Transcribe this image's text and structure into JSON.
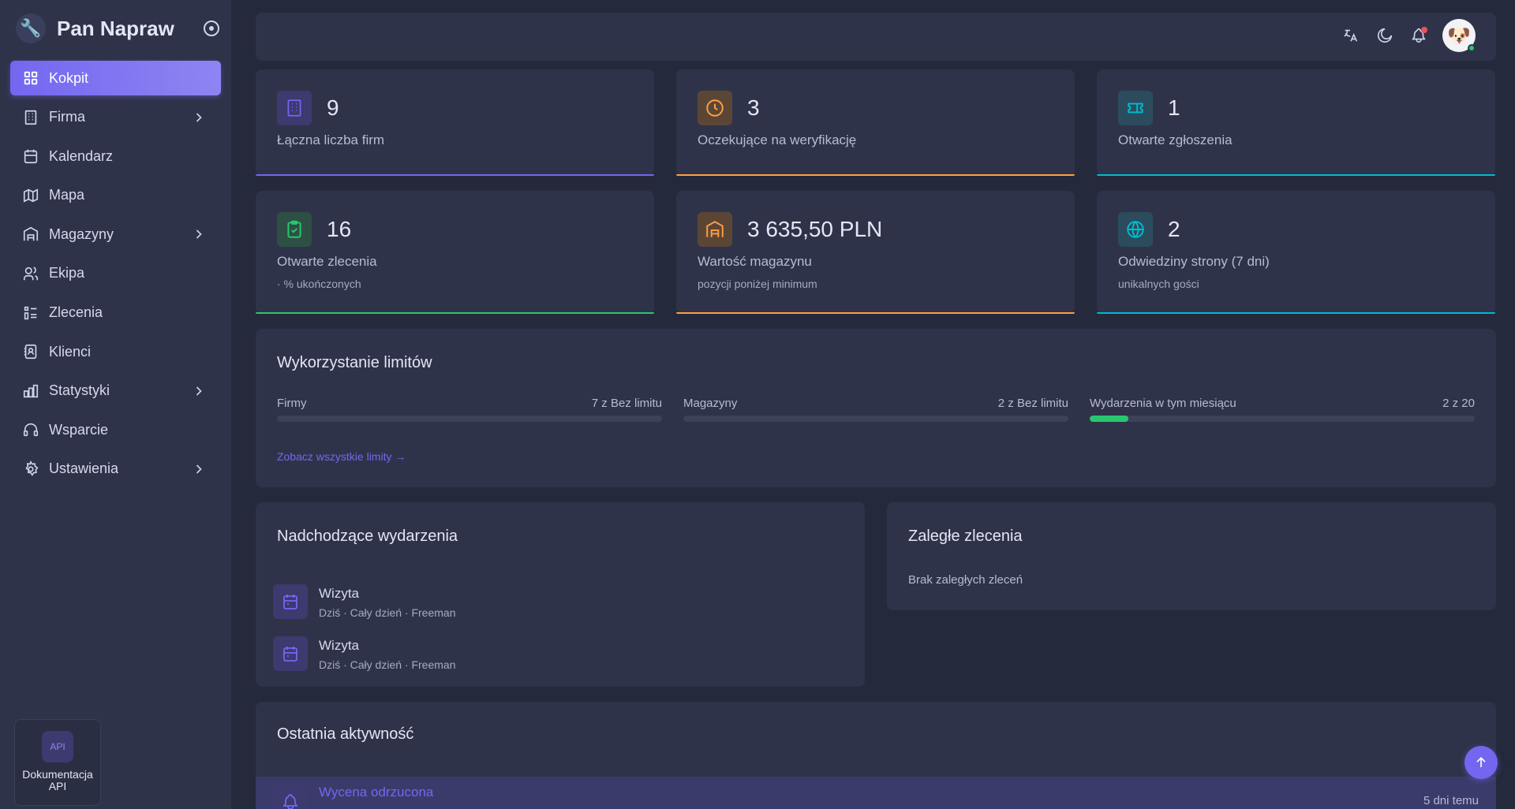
{
  "brand": {
    "name": "Pan Napraw",
    "logo_icon": "mechanic-logo"
  },
  "sidebar": {
    "items": [
      {
        "label": "Kokpit",
        "icon": "dashboard-icon",
        "active": true,
        "has_children": false
      },
      {
        "label": "Firma",
        "icon": "building-icon",
        "active": false,
        "has_children": true
      },
      {
        "label": "Kalendarz",
        "icon": "calendar-icon",
        "active": false,
        "has_children": false
      },
      {
        "label": "Mapa",
        "icon": "map-icon",
        "active": false,
        "has_children": false
      },
      {
        "label": "Magazyny",
        "icon": "warehouse-icon",
        "active": false,
        "has_children": true
      },
      {
        "label": "Ekipa",
        "icon": "users-icon",
        "active": false,
        "has_children": false
      },
      {
        "label": "Zlecenia",
        "icon": "tasks-icon",
        "active": false,
        "has_children": false
      },
      {
        "label": "Klienci",
        "icon": "address-book-icon",
        "active": false,
        "has_children": false
      },
      {
        "label": "Statystyki",
        "icon": "chart-bar-icon",
        "active": false,
        "has_children": true
      },
      {
        "label": "Wsparcie",
        "icon": "headset-icon",
        "active": false,
        "has_children": false
      },
      {
        "label": "Ustawienia",
        "icon": "settings-icon",
        "active": false,
        "has_children": true
      }
    ],
    "api_card": {
      "badge": "API",
      "label_line1": "Dokumentacja",
      "label_line2": "API"
    }
  },
  "topbar": {
    "icons": [
      "translate-icon",
      "moon-icon",
      "bell-icon"
    ],
    "has_notification": true,
    "avatar_status": "online"
  },
  "stats": [
    {
      "value": "9",
      "label": "Łączna liczba firm",
      "sub": "",
      "icon": "building-icon",
      "color": "#7367f0"
    },
    {
      "value": "3",
      "label": "Oczekujące na weryfikację",
      "sub": "",
      "icon": "clock-icon",
      "color": "#ff9f43"
    },
    {
      "value": "1",
      "label": "Otwarte zgłoszenia",
      "sub": "",
      "icon": "ticket-icon",
      "color": "#00bad1"
    },
    {
      "value": "16",
      "label": "Otwarte zlecenia",
      "sub": "· % ukończonych",
      "icon": "clipboard-icon",
      "color": "#28c76f"
    },
    {
      "value": "3 635,50 PLN",
      "label": "Wartość magazynu",
      "sub": "pozycji poniżej minimum",
      "icon": "warehouse-icon",
      "color": "#ff9f43"
    },
    {
      "value": "2",
      "label": "Odwiedziny strony (7 dni)",
      "sub": "unikalnych gości",
      "icon": "globe-icon",
      "color": "#00bad1"
    }
  ],
  "limits": {
    "title": "Wykorzystanie limitów",
    "items": [
      {
        "name": "Firmy",
        "value": "7 z Bez limitu",
        "fraction": 0
      },
      {
        "name": "Magazyny",
        "value": "2 z Bez limitu",
        "fraction": 0
      },
      {
        "name": "Wydarzenia w tym miesiącu",
        "value": "2 z 20",
        "fraction": 0.1
      }
    ],
    "link": "Zobacz wszystkie limity →"
  },
  "events": {
    "title": "Nadchodzące wydarzenia",
    "items": [
      {
        "title": "Wizyta",
        "meta": "Dziś · Cały dzień · Freeman"
      },
      {
        "title": "Wizyta",
        "meta": "Dziś · Cały dzień · Freeman"
      }
    ]
  },
  "overdue": {
    "title": "Zaległe zlecenia",
    "empty": "Brak zaległych zleceń"
  },
  "activity": {
    "title": "Ostatnia aktywność",
    "items": [
      {
        "title": "Wycena odrzucona",
        "time": "5 dni temu"
      }
    ]
  }
}
